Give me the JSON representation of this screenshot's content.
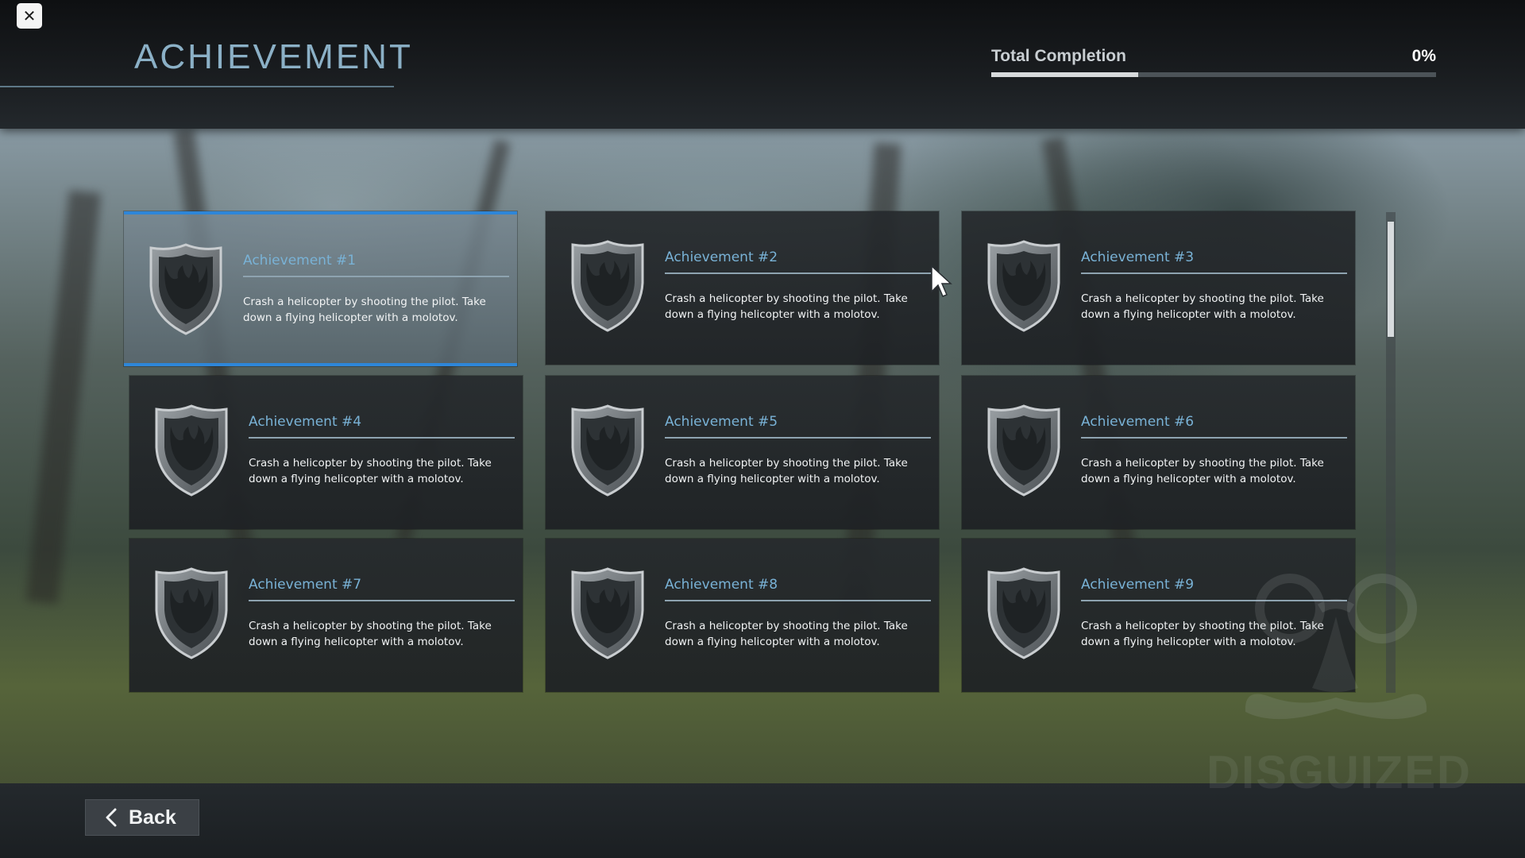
{
  "window": {
    "close_icon": "close-icon"
  },
  "header": {
    "title": "ACHIEVEMENT",
    "completion_label": "Total Completion",
    "completion_value": "0%",
    "completion_bar_fill_fraction": 0.33
  },
  "achievements": [
    {
      "title": "Achievement #1",
      "description": "Crash a helicopter by shooting the pilot. Take down a flying helicopter with a molotov.",
      "icon": "shield-icon",
      "selected": true
    },
    {
      "title": "Achievement #2",
      "description": "Crash a helicopter by shooting the pilot. Take down a flying helicopter with a molotov.",
      "icon": "shield-icon",
      "selected": false
    },
    {
      "title": "Achievement #3",
      "description": "Crash a helicopter by shooting the pilot. Take down a flying helicopter with a molotov.",
      "icon": "shield-icon",
      "selected": false
    },
    {
      "title": "Achievement #4",
      "description": "Crash a helicopter by shooting the pilot. Take down a flying helicopter with a molotov.",
      "icon": "shield-icon",
      "selected": false
    },
    {
      "title": "Achievement #5",
      "description": "Crash a helicopter by shooting the pilot. Take down a flying helicopter with a molotov.",
      "icon": "shield-icon",
      "selected": false
    },
    {
      "title": "Achievement #6",
      "description": "Crash a helicopter by shooting the pilot. Take down a flying helicopter with a molotov.",
      "icon": "shield-icon",
      "selected": false
    },
    {
      "title": "Achievement #7",
      "description": "Crash a helicopter by shooting the pilot. Take down a flying helicopter with a molotov.",
      "icon": "shield-icon",
      "selected": false
    },
    {
      "title": "Achievement #8",
      "description": "Crash a helicopter by shooting the pilot. Take down a flying helicopter with a molotov.",
      "icon": "shield-icon",
      "selected": false
    },
    {
      "title": "Achievement #9",
      "description": "Crash a helicopter by shooting the pilot. Take down a flying helicopter with a molotov.",
      "icon": "shield-icon",
      "selected": false
    }
  ],
  "footer": {
    "back_label": "Back",
    "back_icon": "chevron-left-icon"
  },
  "watermark": {
    "text": "DISGUIZED",
    "icon": "disguise-glasses-mustache-logo"
  },
  "colors": {
    "accent": "#2e86d8",
    "title": "#8bb0c6",
    "card_title": "#79b2d6"
  }
}
